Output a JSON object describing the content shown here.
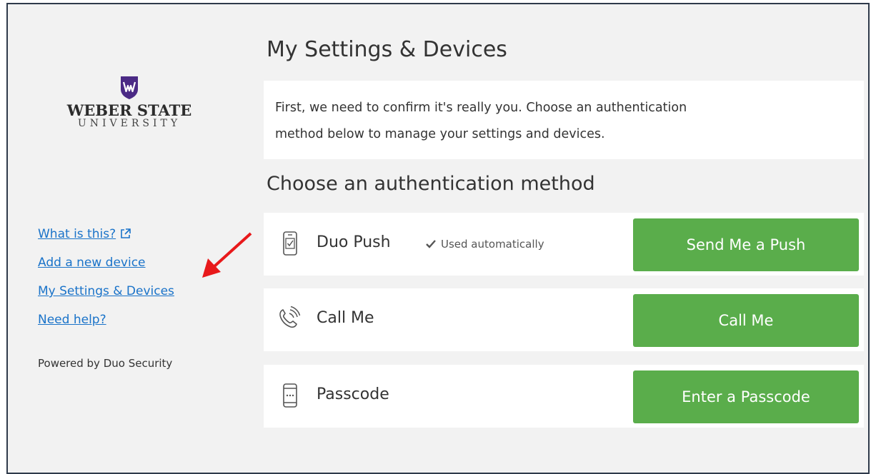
{
  "logo": {
    "name": "WEBER STATE",
    "sub": "UNIVERSITY",
    "shield_color": "#4b2a85"
  },
  "sidebar": {
    "links": [
      {
        "label": "What is this?",
        "icon": "external-link-icon"
      },
      {
        "label": "Add a new device"
      },
      {
        "label": "My Settings & Devices"
      },
      {
        "label": "Need help?"
      }
    ],
    "powered_by": "Powered by Duo Security"
  },
  "annotation": {
    "icon": "red-arrow-icon",
    "color": "#e8191b"
  },
  "main": {
    "title": "My Settings & Devices",
    "intro_line1": "First, we need to confirm it's really you. Choose an authentication",
    "intro_line2": "method below to manage your settings and devices.",
    "section_title": "Choose an authentication method",
    "methods": [
      {
        "icon": "phone-push-icon",
        "label": "Duo Push",
        "note": "Used automatically",
        "button": "Send Me a Push"
      },
      {
        "icon": "phone-call-icon",
        "label": "Call Me",
        "button": "Call Me"
      },
      {
        "icon": "passcode-device-icon",
        "label": "Passcode",
        "button": "Enter a Passcode"
      }
    ]
  },
  "colors": {
    "button_green": "#5aad4b",
    "link_blue": "#1a73c9",
    "panel_bg": "#f2f2f2"
  }
}
